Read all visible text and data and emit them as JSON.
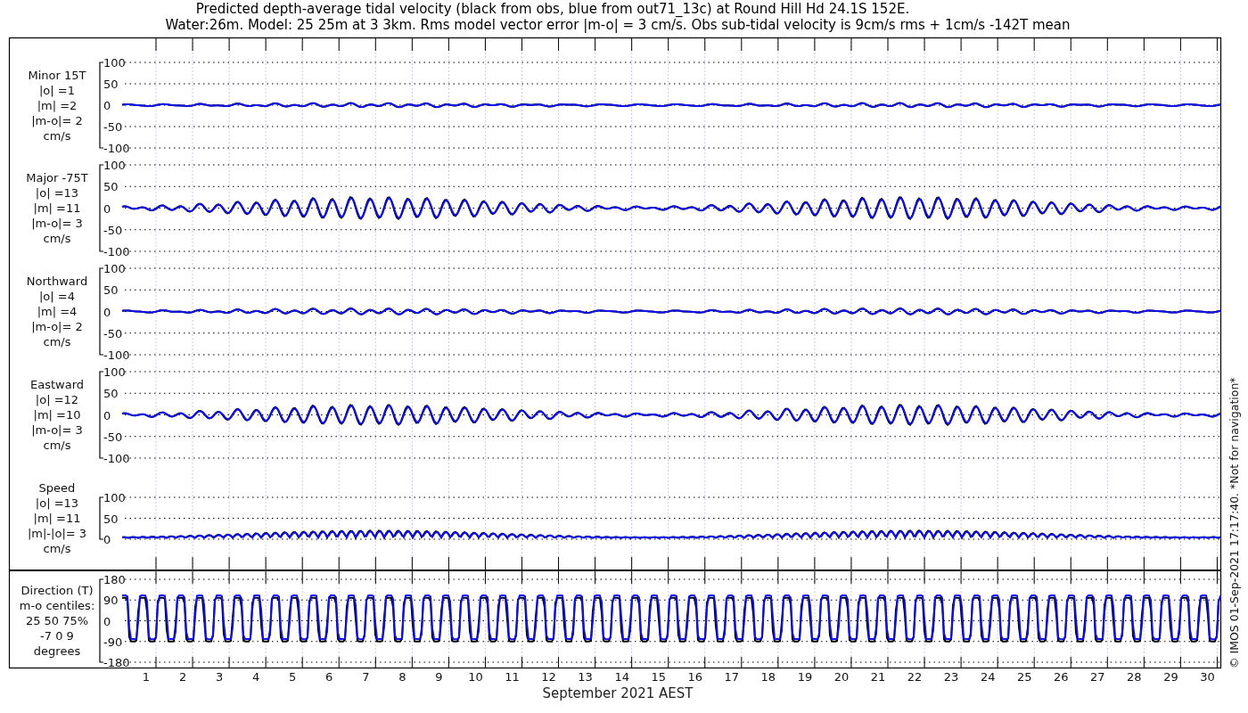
{
  "title_lines": [
    "Predicted depth-average tidal velocity (black from obs, blue from out71_13c) at Round Hill Hd 24.1S 152E.",
    "Water:26m. Model: 25 25m at 3 3km. Rms model vector error |m-o| = 3 cm/s. Obs sub-tidal velocity is 9cm/s rms + 1cm/s -142T mean"
  ],
  "panels": [
    {
      "kind": "velocity",
      "label_lines": [
        "Minor 15T",
        "|o| =1",
        "|m| =2",
        "|m-o|= 2",
        "cm/s"
      ],
      "yticks": [
        "100",
        "50",
        "0",
        "-50",
        "-100"
      ]
    },
    {
      "kind": "velocity",
      "label_lines": [
        "Major -75T",
        "|o| =13",
        "|m| =11",
        "|m-o|= 3",
        "cm/s"
      ],
      "yticks": [
        "100",
        "50",
        "0",
        "-50",
        "-100"
      ]
    },
    {
      "kind": "velocity",
      "label_lines": [
        "Northward",
        "|o| =4",
        "|m| =4",
        "|m-o|= 2",
        "cm/s"
      ],
      "yticks": [
        "100",
        "50",
        "0",
        "-50",
        "-100"
      ]
    },
    {
      "kind": "velocity",
      "label_lines": [
        "Eastward",
        "|o| =12",
        "|m| =10",
        "|m-o|= 3",
        "cm/s"
      ],
      "yticks": [
        "100",
        "50",
        "0",
        "-50",
        "-100"
      ]
    },
    {
      "kind": "speed",
      "label_lines": [
        "Speed",
        "|o| =13",
        "|m| =11",
        "|m|-|o|= 3",
        "cm/s"
      ],
      "yticks": [
        "100",
        "50",
        "0"
      ]
    },
    {
      "kind": "direction",
      "label_lines": [
        "Direction (T)",
        "m-o centiles:",
        "25  50  75%",
        "-7  0  9",
        "degrees"
      ],
      "yticks": [
        "180",
        "90",
        "0",
        "-90",
        "-180"
      ]
    }
  ],
  "x_tick_labels": [
    "1",
    "2",
    "3",
    "4",
    "5",
    "6",
    "7",
    "8",
    "9",
    "10",
    "11",
    "12",
    "13",
    "14",
    "15",
    "16",
    "17",
    "18",
    "19",
    "20",
    "21",
    "22",
    "23",
    "24",
    "25",
    "26",
    "27",
    "28",
    "29",
    "30"
  ],
  "xlabel": "September 2021 AEST",
  "footer": "© IMOS 01-Sep-2021 17:17:40. *Not for navigation*"
}
